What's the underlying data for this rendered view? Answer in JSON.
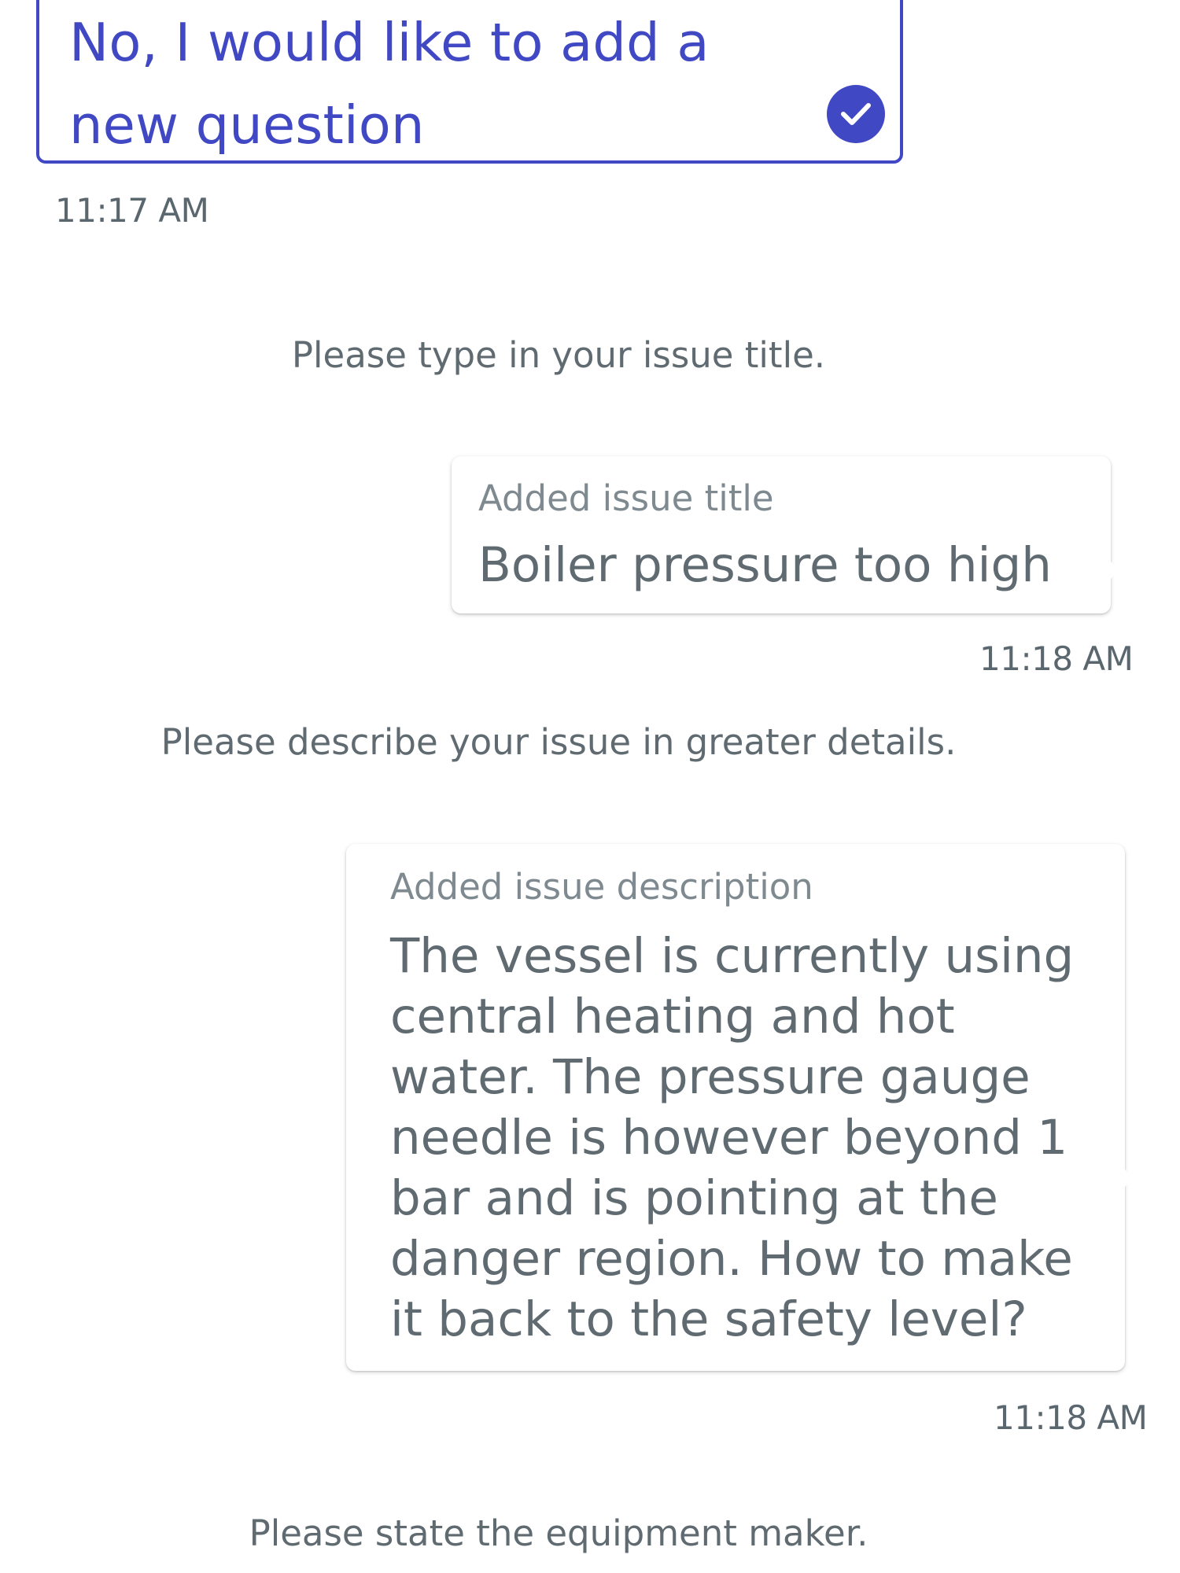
{
  "selected_option": {
    "text": "No, I would like to add a new question",
    "icon": "checkmark-icon",
    "accent": "#4148c4"
  },
  "messages": [
    {
      "time": "11:17 AM"
    },
    {
      "prompt": "Please type in your issue title."
    },
    {
      "label": "Added issue title",
      "text": "Boiler pressure too high",
      "time": "11:18 AM"
    },
    {
      "prompt": "Please describe your issue in greater details."
    },
    {
      "label": "Added issue description",
      "text": "The vessel is currently using central heating and hot water. The pressure gauge needle is however beyond 1 bar and is pointing at the danger region. How to make it back to the safety level?",
      "time": "11:18 AM"
    },
    {
      "prompt": "Please state the equipment maker."
    }
  ],
  "colors": {
    "text_gray": "#5f6a71",
    "label_gray": "#7e8a90",
    "background": "#ffffff"
  }
}
